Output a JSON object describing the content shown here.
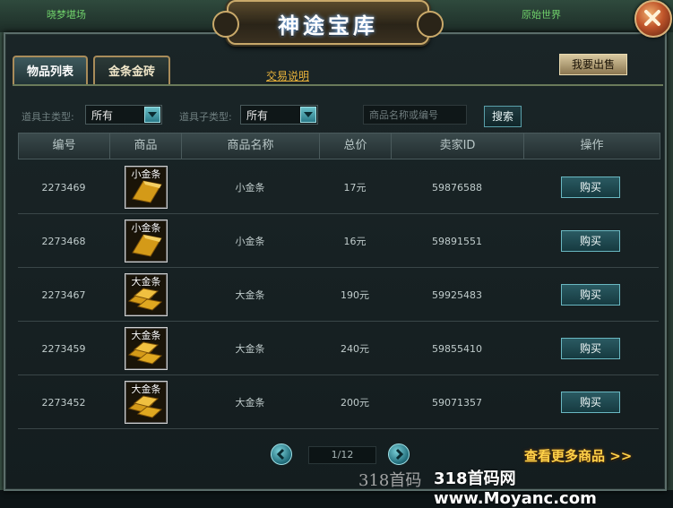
{
  "window": {
    "title": "神途宝库",
    "bg_hint_left": "晓梦堪场",
    "bg_hint_right": "原始世界"
  },
  "tabs": [
    {
      "label": "物品列表",
      "active": true
    },
    {
      "label": "金条金砖",
      "active": false
    }
  ],
  "help_link": "交易说明",
  "sell_button": "我要出售",
  "filters": {
    "main_type_label": "道具主类型:",
    "main_type_value": "所有",
    "sub_type_label": "道具子类型:",
    "sub_type_value": "所有",
    "search_placeholder": "商品名称或编号",
    "search_button": "搜索"
  },
  "table": {
    "headers": [
      "编号",
      "商品",
      "商品名称",
      "总价",
      "卖家ID",
      "操作"
    ],
    "rows": [
      {
        "id": "2273469",
        "icon_label": "小金条",
        "name": "小金条",
        "price": "17元",
        "seller": "59876588",
        "action": "购买"
      },
      {
        "id": "2273468",
        "icon_label": "小金条",
        "name": "小金条",
        "price": "16元",
        "seller": "59891551",
        "action": "购买"
      },
      {
        "id": "2273467",
        "icon_label": "大金条",
        "name": "大金条",
        "price": "190元",
        "seller": "59925483",
        "action": "购买"
      },
      {
        "id": "2273459",
        "icon_label": "大金条",
        "name": "大金条",
        "price": "240元",
        "seller": "59855410",
        "action": "购买"
      },
      {
        "id": "2273452",
        "icon_label": "大金条",
        "name": "大金条",
        "price": "200元",
        "seller": "59071357",
        "action": "购买"
      }
    ]
  },
  "pager": {
    "current": "1/12"
  },
  "more_link": "查看更多商品 >>",
  "watermark": {
    "text_a": "318首码",
    "text_b": "318首码网 www.Moyanc.com"
  },
  "colors": {
    "accent_gold": "#e9b23a",
    "title_glow": "#7ab8ff",
    "button_teal": "#2a5a62"
  }
}
